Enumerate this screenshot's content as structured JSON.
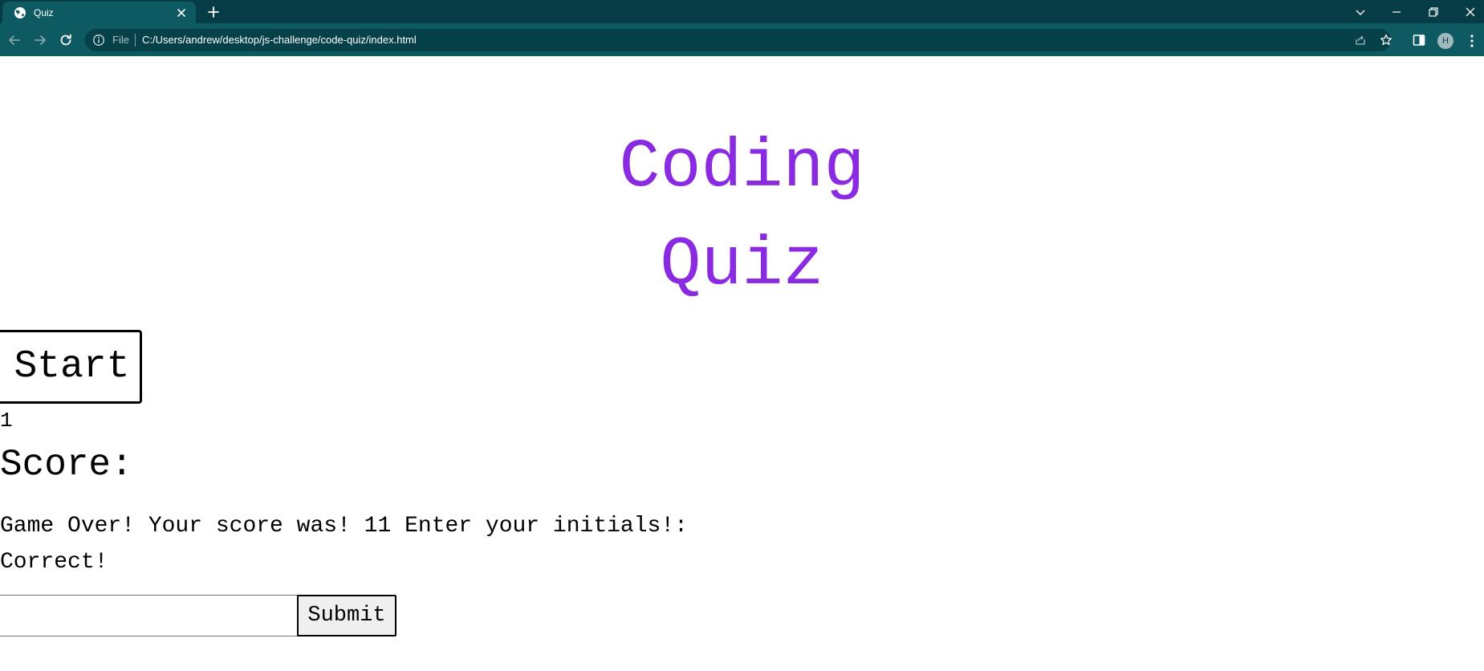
{
  "browser": {
    "tab": {
      "title": "Quiz"
    },
    "address_bar": {
      "scheme_label": "File",
      "url": "C:/Users/andrew/desktop/js-challenge/code-quiz/index.html"
    },
    "profile_initial": "H",
    "colors": {
      "tabbar": "#063c45",
      "toolbar": "#0e5a62",
      "omnibox": "#06414a"
    }
  },
  "page": {
    "title_line1": "Coding",
    "title_line2": "Quiz",
    "start_label": "Start",
    "counter": "1",
    "score_label": "Score:",
    "game_over": "Game Over! Your score was! 11 Enter your initials!:",
    "feedback": "Correct!",
    "initials_placeholder": "",
    "submit_label": "Submit",
    "colors": {
      "title": "#8a2be2",
      "text": "#000000"
    }
  },
  "icons": {
    "favicon": "globe-icon",
    "tab_close": "close-icon",
    "new_tab": "plus-icon",
    "back": "back-arrow-icon",
    "forward": "forward-arrow-icon",
    "reload": "reload-icon",
    "site_info": "info-icon",
    "share": "share-icon",
    "bookmark": "star-icon",
    "side_panel": "side-panel-icon",
    "menu": "kebab-menu-icon"
  }
}
